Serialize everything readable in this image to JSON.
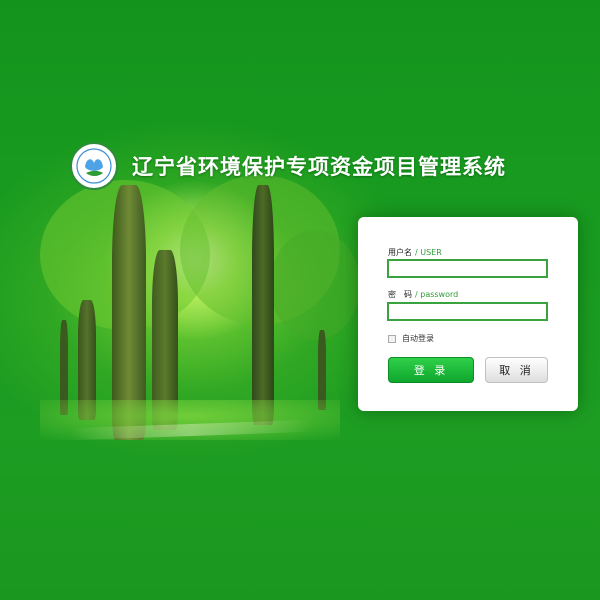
{
  "header": {
    "title": "辽宁省环境保护专项资金项目管理系统",
    "logo_icon": "environment-protection-logo"
  },
  "login": {
    "username_label": "用户名",
    "username_label_en": "/ USER",
    "username_value": "",
    "password_label": "密　码",
    "password_label_en": "/ password",
    "password_value": "",
    "remember_label": "自动登录",
    "remember_checked": false,
    "login_button": "登 录",
    "cancel_button": "取 消"
  },
  "colors": {
    "background": "#1b9a1f",
    "accent": "#3aa33f",
    "login_button": "#17b234"
  }
}
